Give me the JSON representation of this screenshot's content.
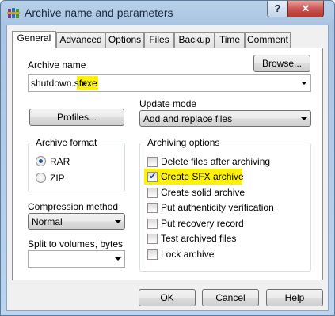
{
  "window": {
    "title": "Archive name and parameters",
    "help_label": "?",
    "close_label": "✕",
    "app_icon": "winrar-books-icon"
  },
  "tabs": [
    {
      "label": "General",
      "active": true
    },
    {
      "label": "Advanced",
      "active": false
    },
    {
      "label": "Options",
      "active": false
    },
    {
      "label": "Files",
      "active": false
    },
    {
      "label": "Backup",
      "active": false
    },
    {
      "label": "Time",
      "active": false
    },
    {
      "label": "Comment",
      "active": false
    }
  ],
  "general": {
    "archive_name_label": "Archive name",
    "browse_label": "Browse...",
    "archive_name_value_base": "shutdown.sfx",
    "archive_name_value_ext": ".exe",
    "profiles_label": "Profiles...",
    "update_mode_label": "Update mode",
    "update_mode_value": "Add and replace files",
    "archive_format": {
      "title": "Archive format",
      "options": [
        {
          "label": "RAR",
          "selected": true
        },
        {
          "label": "ZIP",
          "selected": false
        }
      ]
    },
    "compression_label": "Compression method",
    "compression_value": "Normal",
    "split_label": "Split to volumes, bytes",
    "split_value": "",
    "archiving_options": {
      "title": "Archiving options",
      "items": [
        {
          "label": "Delete files after archiving",
          "checked": false
        },
        {
          "label": "Create SFX archive",
          "checked": true
        },
        {
          "label": "Create solid archive",
          "checked": false
        },
        {
          "label": "Put authenticity verification",
          "checked": false
        },
        {
          "label": "Put recovery record",
          "checked": false
        },
        {
          "label": "Test archived files",
          "checked": false
        },
        {
          "label": "Lock archive",
          "checked": false
        }
      ]
    },
    "highlight_color": "#fff200"
  },
  "footer": {
    "ok_label": "OK",
    "cancel_label": "Cancel",
    "help_label": "Help"
  }
}
